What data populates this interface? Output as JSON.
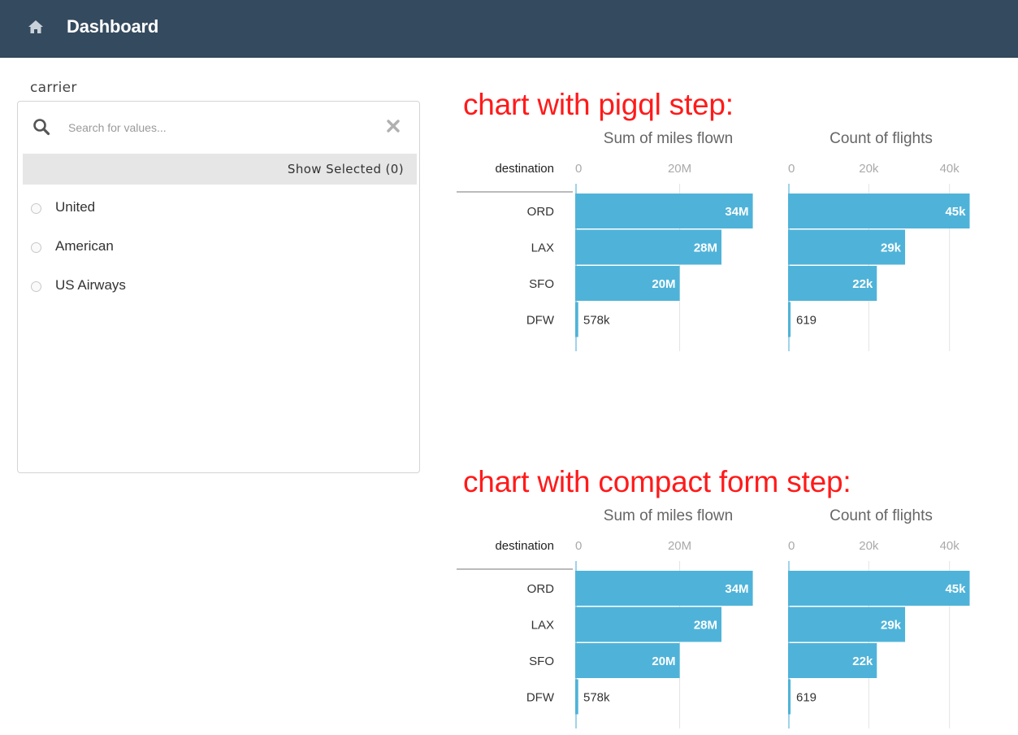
{
  "header": {
    "title": "Dashboard",
    "icon": "home-icon"
  },
  "filter": {
    "label": "carrier",
    "search_placeholder": "Search for values...",
    "show_selected_label": "Show Selected (0)",
    "options": [
      {
        "label": "United"
      },
      {
        "label": "American"
      },
      {
        "label": "US Airways"
      }
    ]
  },
  "colors": {
    "bar": "#4fb3d9",
    "header_bg": "#344a5e",
    "title_red": "#ff1a1a"
  },
  "sections": [
    {
      "title": "chart with pigql step:"
    },
    {
      "title": "chart with compact form step:"
    }
  ],
  "chart_data": [
    {
      "type": "bar",
      "orientation": "horizontal",
      "row_header": "destination",
      "categories": [
        "ORD",
        "LAX",
        "SFO",
        "DFW"
      ],
      "panels": [
        {
          "name": "Sum of miles flown",
          "values": [
            34000000,
            28000000,
            20000000,
            578000
          ],
          "labels": [
            "34M",
            "28M",
            "20M",
            "578k"
          ],
          "ticks": [
            "0",
            "20M"
          ],
          "tick_values": [
            0,
            20000000
          ],
          "xlim": [
            0,
            35000000
          ]
        },
        {
          "name": "Count of flights",
          "values": [
            45000,
            29000,
            22000,
            619
          ],
          "labels": [
            "45k",
            "29k",
            "22k",
            "619"
          ],
          "ticks": [
            "0",
            "20k",
            "40k"
          ],
          "tick_values": [
            0,
            20000,
            40000
          ],
          "xlim": [
            0,
            45300
          ]
        }
      ]
    },
    {
      "type": "bar",
      "orientation": "horizontal",
      "row_header": "destination",
      "categories": [
        "ORD",
        "LAX",
        "SFO",
        "DFW"
      ],
      "panels": [
        {
          "name": "Sum of miles flown",
          "values": [
            34000000,
            28000000,
            20000000,
            578000
          ],
          "labels": [
            "34M",
            "28M",
            "20M",
            "578k"
          ],
          "ticks": [
            "0",
            "20M"
          ],
          "tick_values": [
            0,
            20000000
          ],
          "xlim": [
            0,
            35000000
          ]
        },
        {
          "name": "Count of flights",
          "values": [
            45000,
            29000,
            22000,
            619
          ],
          "labels": [
            "45k",
            "29k",
            "22k",
            "619"
          ],
          "ticks": [
            "0",
            "20k",
            "40k"
          ],
          "tick_values": [
            0,
            20000,
            40000
          ],
          "xlim": [
            0,
            45300
          ]
        }
      ]
    }
  ]
}
